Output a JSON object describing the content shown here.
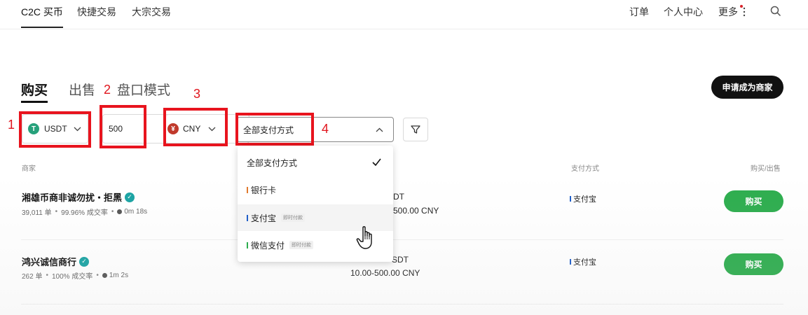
{
  "topnav": {
    "tabs": [
      "C2C 买币",
      "快捷交易",
      "大宗交易"
    ],
    "right": [
      "订单",
      "个人中心",
      "更多"
    ]
  },
  "main_tabs": [
    "购买",
    "出售",
    "盘口模式"
  ],
  "merchant_button": "申请成为商家",
  "filters": {
    "coin": "USDT",
    "amount": "500",
    "fiat": "CNY",
    "fiat_symbol": "¥",
    "payment": "全部支付方式"
  },
  "annotations": [
    "1",
    "2",
    "3",
    "4"
  ],
  "table": {
    "headers": [
      "商家",
      "支付方式",
      "购买/出售"
    ],
    "rows": [
      {
        "merchant": "湘雄币商非诚勿扰・拒黑",
        "orders": "39,011 单",
        "completion": "99.96% 成交率",
        "time": "0m 18s",
        "amount_line1": "DT",
        "amount_line2": "500.00 CNY",
        "payment": "支付宝",
        "action": "购买"
      },
      {
        "merchant": "鸿兴诚信商行",
        "orders": "262 单",
        "completion": "100% 成交率",
        "time": "1m 2s",
        "amount_line1": "SDT",
        "amount_line2": "10.00-500.00 CNY",
        "payment": "支付宝",
        "action": "购买"
      }
    ]
  },
  "dropdown": {
    "items": [
      {
        "label": "全部支付方式",
        "selected": true
      },
      {
        "label": "银行卡",
        "color": "#e07a2e"
      },
      {
        "label": "支付宝",
        "color": "#1f5ec8",
        "badge": "即时付款"
      },
      {
        "label": "微信支付",
        "color": "#2dad4e",
        "badge": "即时付款"
      }
    ]
  },
  "colors": {
    "buy_green": "#2dad4e",
    "annotation_red": "#e8141e",
    "usdt_green": "#26a17b",
    "cny_red": "#c0392b"
  }
}
